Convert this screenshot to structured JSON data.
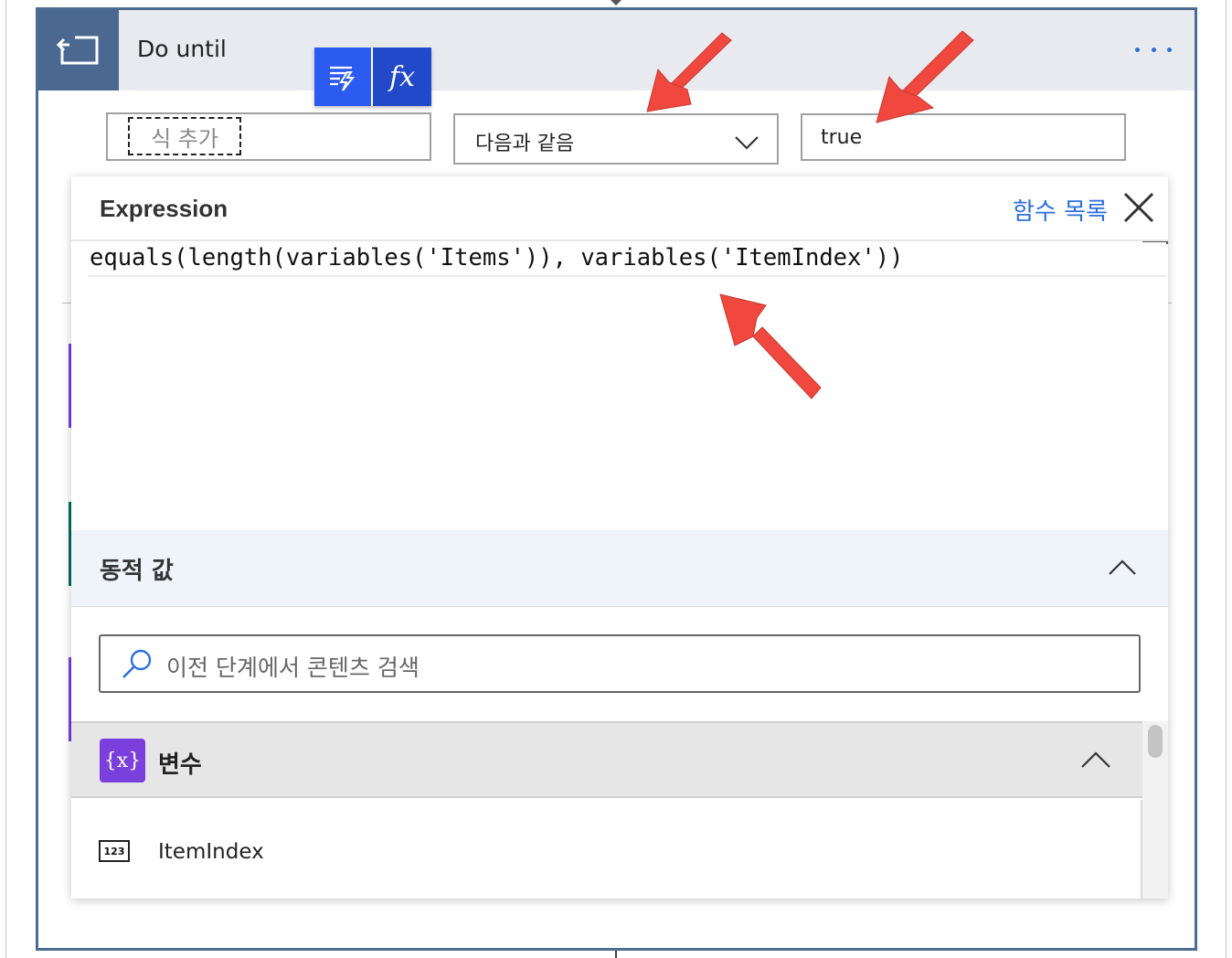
{
  "header": {
    "title": "Do until",
    "more_label": "..."
  },
  "toolbar": {
    "dynamic_content_icon": "dynamic-content-icon",
    "expression_label": "fx"
  },
  "condition": {
    "left_placeholder": "식 추가",
    "operator": "다음과 같음",
    "value": "true"
  },
  "expression_panel": {
    "title": "Expression",
    "function_list_link": "함수 목록",
    "expression": "equals(length(variables('Items')), variables('ItemIndex'))"
  },
  "dynamic_content": {
    "title": "동적 값",
    "search_placeholder": "이전 단계에서 콘텐츠 검색",
    "sections": [
      {
        "icon_label": "{x}",
        "title": "변수",
        "items": [
          {
            "type_icon": "123",
            "label": "ItemIndex"
          }
        ]
      }
    ]
  },
  "colors": {
    "header_icon_bg": "#4a6890",
    "card_border": "#4c6d93",
    "toolbar_dynamic": "#2b5bf0",
    "toolbar_expression": "#2249c9",
    "link": "#2b6fde",
    "variable_icon": "#7a3fdc",
    "annotation_arrow": "#f0483e"
  }
}
